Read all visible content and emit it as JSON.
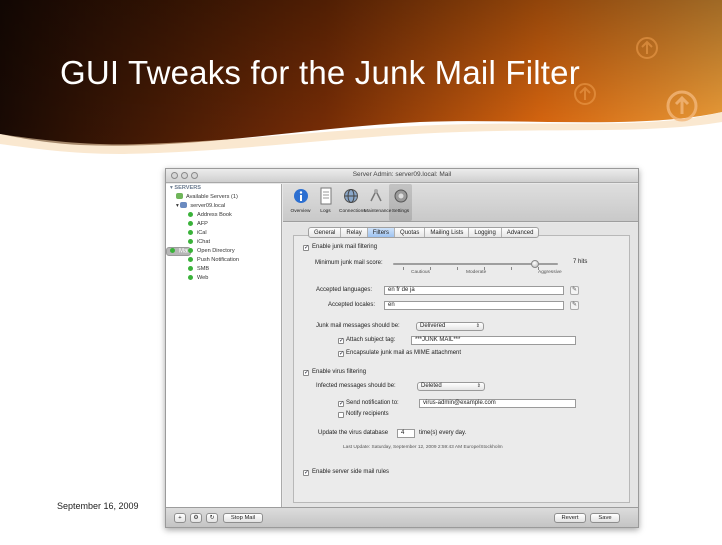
{
  "slide": {
    "title": "GUI Tweaks for the Junk Mail Filter",
    "date": "September 16, 2009"
  },
  "window": {
    "title": "Server Admin: server09.local: Mail"
  },
  "sidebar": {
    "header": "SERVERS",
    "available": "Available Servers (1)",
    "server": "server09.local",
    "services": [
      "Address Book",
      "AFP",
      "iCal",
      "iChat",
      "Mail",
      "Open Directory",
      "Push Notification",
      "SMB",
      "Web"
    ],
    "selected": "Mail"
  },
  "toolbar": {
    "buttons": [
      "Overview",
      "Logs",
      "Connections",
      "Maintenance",
      "Settings"
    ]
  },
  "tabs": [
    "General",
    "Relay",
    "Filters",
    "Quotas",
    "Mailing Lists",
    "Logging",
    "Advanced"
  ],
  "active_tab": "Filters",
  "filters": {
    "enable_junk": "Enable junk mail filtering",
    "min_score_label": "Minimum junk mail score:",
    "min_score_value": "7 hits",
    "min_score_level": 0.86,
    "scale_cautious": "Cautious",
    "scale_moderate": "Moderate",
    "scale_aggressive": "Aggressive",
    "accepted_languages_label": "Accepted languages:",
    "accepted_languages": "en fr de ja",
    "accepted_locales_label": "Accepted locales:",
    "accepted_locales": "en",
    "junk_should_be_label": "Junk mail messages should be:",
    "junk_should_be": "Delivered",
    "attach_subject_tag": "Attach subject tag:",
    "subject_tag": "***JUNK MAIL***",
    "encapsulate": "Encapsulate junk mail as MIME attachment",
    "enable_virus": "Enable virus filtering",
    "infected_should_be_label": "Infected messages should be:",
    "infected_should_be": "Deleted",
    "send_notification": "Send notification to:",
    "notification_address": "virus-admin@example.com",
    "notify_recipients": "Notify recipients",
    "update_label": "Update the virus database",
    "update_count": "4",
    "update_suffix": "time(s) every day.",
    "last_update": "Last Update: Saturday, September 12, 2009 2:59:43 AM Europe/Stockholm",
    "enable_server_rules": "Enable server side mail rules"
  },
  "bottom": {
    "add": "+",
    "gear": "⚙",
    "action": "↻",
    "stop_mail": "Stop Mail",
    "revert": "Revert",
    "save": "Save"
  }
}
